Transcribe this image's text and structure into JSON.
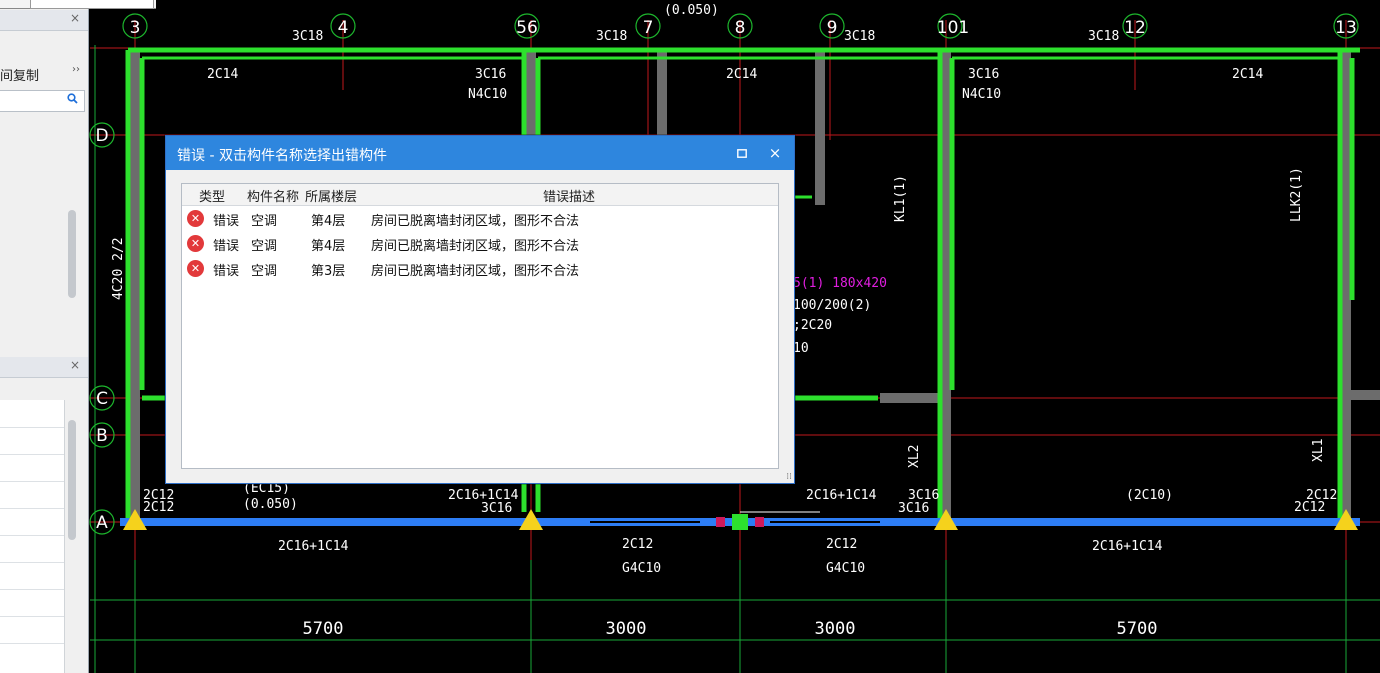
{
  "left_panel": {
    "copy_label": "间复制",
    "expand_glyph": "››",
    "search_icon": "search-icon",
    "close_glyph": "×"
  },
  "dialog": {
    "title": "错误 - 双击构件名称选择出错构件",
    "maximize_glyph": "▫",
    "close_glyph": "×",
    "columns": [
      "类型",
      "构件名称",
      "所属楼层",
      "错误描述"
    ],
    "rows": [
      {
        "type": "错误",
        "name": "空调",
        "floor": "第4层",
        "desc": "房间已脱离墙封闭区域，图形不合法"
      },
      {
        "type": "错误",
        "name": "空调",
        "floor": "第4层",
        "desc": "房间已脱离墙封闭区域，图形不合法"
      },
      {
        "type": "错误",
        "name": "空调",
        "floor": "第3层",
        "desc": "房间已脱离墙封闭区域，图形不合法"
      }
    ],
    "error_icon": "error-icon"
  },
  "cad": {
    "axis_numbers": [
      "3",
      "4",
      "56",
      "7",
      "8",
      "9",
      "101",
      "12",
      "13"
    ],
    "axis_letters": [
      "D",
      "C",
      "B",
      "A"
    ],
    "dimensions": [
      "5700",
      "3000",
      "3000",
      "5700"
    ],
    "labels": {
      "top_3c18_a": "3C18",
      "top_3c18_b": "3C18",
      "top_3c18_c": "3C18",
      "top_3c18_d": "3C18",
      "c14_a": "2C14",
      "c14_b": "2C14",
      "c14_c": "2C14",
      "c16_a": "3C16",
      "n4c10_a": "N4C10",
      "c16_b": "3C16",
      "n4c10_b": "N4C10",
      "side_4c20": "4C20 2/2",
      "kl1": "KL1(1)",
      "llk2": "LLK2(1)",
      "beam_mag": "5(1) 180x420",
      "beam_1": "100/200(2)",
      "beam_2": ";2C20",
      "beam_3": "10",
      "xl2": "XL2",
      "xl1": "XL1",
      "a_2c12_l": "2C12",
      "a_2c12_l2": "2C12",
      "a_ec15": "(EC15)",
      "a_0050": "(0.050)",
      "a_2c16p1c14": "2C16+1C14",
      "a_3c16": "3C16",
      "a_2c16p1c14_b": "2C16+1C14",
      "a_3c16_b": "3C16",
      "a_3c16_c": "3C16",
      "a_2c10": "(2C10)",
      "a_2c12_r": "2C12",
      "a_2c12_r2": "2C12",
      "b_left": "2C16+1C14",
      "b_mid1": "2C12",
      "b_g4c10_1": "G4C10",
      "b_mid2": "2C12",
      "b_g4c10_2": "G4C10",
      "b_right": "2C16+1C14",
      "top_ref": "(0.050)"
    }
  }
}
